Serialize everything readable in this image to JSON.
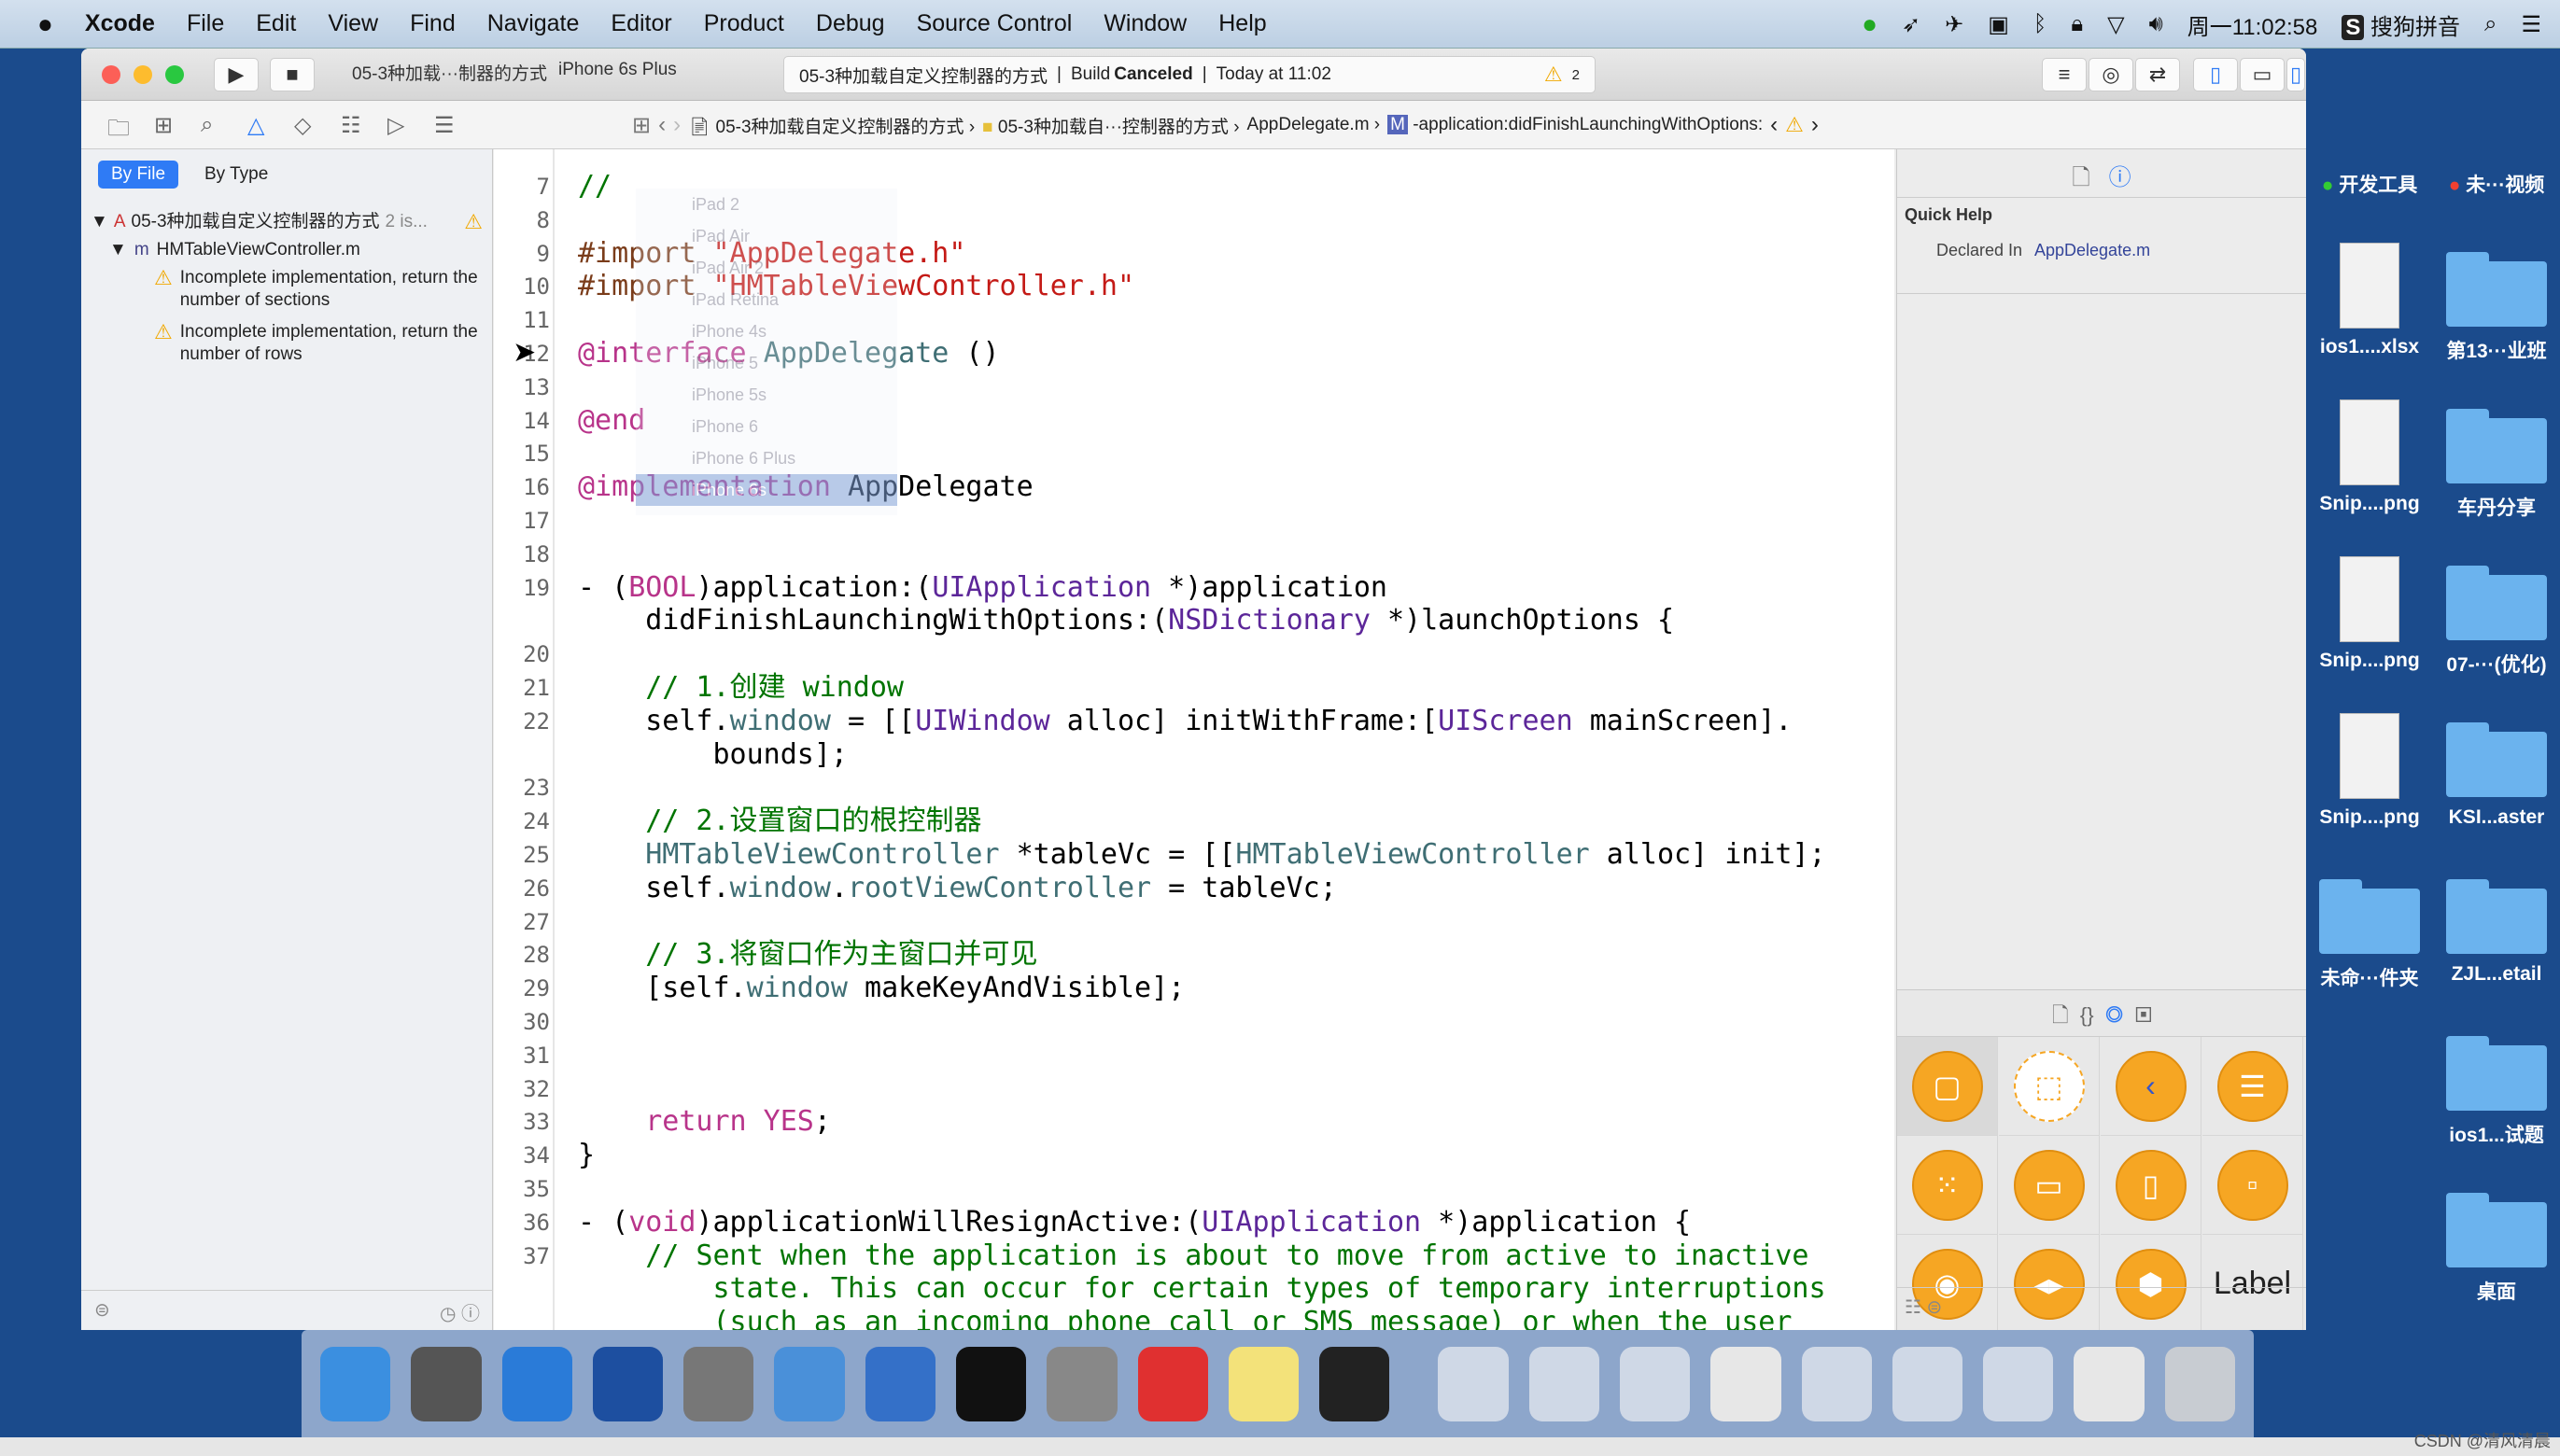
{
  "menubar": {
    "apple": "",
    "app": "Xcode",
    "items": [
      "File",
      "Edit",
      "View",
      "Find",
      "Navigate",
      "Editor",
      "Product",
      "Debug",
      "Source Control",
      "Window",
      "Help"
    ],
    "clock": "周一11:02:58",
    "ime": "搜狗拼音"
  },
  "toolbar": {
    "scheme": "05-3种加载···制器的方式",
    "device": "iPhone 6s Plus",
    "project": "05-3种加载自定义控制器的方式",
    "status_prefix": "Build",
    "status": "Canceled",
    "time": "Today at 11:02",
    "warnings": "2"
  },
  "jumpbar": [
    "05-3种加载自定义控制器的方式",
    "05-3种加载自···控制器的方式",
    "AppDelegate.m",
    "-application:didFinishLaunchingWithOptions:"
  ],
  "navigator": {
    "tabs": [
      "By File",
      "By Type"
    ],
    "project": "05-3种加载自定义控制器的方式",
    "project_count": "2 is...",
    "file": "HMTableViewController.m",
    "issues": [
      "Incomplete implementation, return the number of sections",
      "Incomplete implementation, return the number of rows"
    ]
  },
  "device_menu": [
    "iPad 2",
    "iPad Air",
    "iPad Air 2",
    "iPad Retina",
    "iPhone 4s",
    "iPhone 5",
    "iPhone 5s",
    "iPhone 6",
    "iPhone 6 Plus",
    "iPhone 6s"
  ],
  "device_menu_selected": "iPhone 6s",
  "code_lines": [
    {
      "n": "7",
      "t": [
        [
          "c",
          "//"
        ]
      ]
    },
    {
      "n": "8",
      "t": []
    },
    {
      "n": "9",
      "t": [
        [
          "pp",
          "#import "
        ],
        [
          "s",
          "\"AppDelegate.h\""
        ]
      ]
    },
    {
      "n": "10",
      "t": [
        [
          "pp",
          "#import "
        ],
        [
          "s",
          "\"HMTableViewController.h\""
        ]
      ]
    },
    {
      "n": "11",
      "t": []
    },
    {
      "n": "12",
      "t": [
        [
          "k",
          "@interface "
        ],
        [
          "cl",
          "AppDelegate"
        ],
        [
          "p",
          " ()"
        ]
      ]
    },
    {
      "n": "13",
      "t": []
    },
    {
      "n": "14",
      "t": [
        [
          "k",
          "@end"
        ]
      ]
    },
    {
      "n": "15",
      "t": []
    },
    {
      "n": "16",
      "t": [
        [
          "k",
          "@implementation "
        ],
        [
          "p",
          "AppDelegate"
        ]
      ]
    },
    {
      "n": "17",
      "t": []
    },
    {
      "n": "18",
      "t": []
    },
    {
      "n": "19",
      "t": [
        [
          "p",
          "- ("
        ],
        [
          "k",
          "BOOL"
        ],
        [
          "p",
          ")application:("
        ],
        [
          "sy",
          "UIApplication"
        ],
        [
          "p",
          " *)application"
        ]
      ]
    },
    {
      "n": "",
      "t": [
        [
          "p",
          "    didFinishLaunchingWithOptions:("
        ],
        [
          "sy",
          "NSDictionary"
        ],
        [
          "p",
          " *)launchOptions {"
        ]
      ]
    },
    {
      "n": "20",
      "t": []
    },
    {
      "n": "21",
      "t": [
        [
          "c",
          "    // 1.创建 window"
        ]
      ]
    },
    {
      "n": "22",
      "t": [
        [
          "p",
          "    self."
        ],
        [
          "cl",
          "window"
        ],
        [
          "p",
          " = [["
        ],
        [
          "sy",
          "UIWindow"
        ],
        [
          "p",
          " alloc] initWithFrame:["
        ],
        [
          "sy",
          "UIScreen"
        ],
        [
          "p",
          " mainScreen]."
        ]
      ]
    },
    {
      "n": "",
      "t": [
        [
          "p",
          "        bounds];"
        ]
      ]
    },
    {
      "n": "23",
      "t": []
    },
    {
      "n": "24",
      "t": [
        [
          "c",
          "    // 2.设置窗口的根控制器"
        ]
      ]
    },
    {
      "n": "25",
      "t": [
        [
          "p",
          "    "
        ],
        [
          "cl",
          "HMTableViewController"
        ],
        [
          "p",
          " *tableVc = [["
        ],
        [
          "cl",
          "HMTableViewController"
        ],
        [
          "p",
          " alloc] init];"
        ]
      ]
    },
    {
      "n": "26",
      "t": [
        [
          "p",
          "    self."
        ],
        [
          "cl",
          "window"
        ],
        [
          "p",
          "."
        ],
        [
          "cl",
          "rootViewController"
        ],
        [
          "p",
          " = tableVc;"
        ]
      ]
    },
    {
      "n": "27",
      "t": []
    },
    {
      "n": "28",
      "t": [
        [
          "c",
          "    // 3.将窗口作为主窗口并可见"
        ]
      ]
    },
    {
      "n": "29",
      "t": [
        [
          "p",
          "    [self."
        ],
        [
          "cl",
          "window"
        ],
        [
          "p",
          " makeKeyAndVisible];"
        ]
      ]
    },
    {
      "n": "30",
      "t": []
    },
    {
      "n": "31",
      "t": []
    },
    {
      "n": "32",
      "t": []
    },
    {
      "n": "33",
      "t": [
        [
          "k",
          "    return YES"
        ],
        [
          "p",
          ";"
        ]
      ]
    },
    {
      "n": "34",
      "t": [
        [
          "p",
          "}"
        ]
      ]
    },
    {
      "n": "35",
      "t": []
    },
    {
      "n": "36",
      "t": [
        [
          "p",
          "- ("
        ],
        [
          "k",
          "void"
        ],
        [
          "p",
          ")applicationWillResignActive:("
        ],
        [
          "sy",
          "UIApplication"
        ],
        [
          "p",
          " *)application {"
        ]
      ]
    },
    {
      "n": "37",
      "t": [
        [
          "c",
          "    // Sent when the application is about to move from active to inactive"
        ]
      ]
    },
    {
      "n": "",
      "t": [
        [
          "c",
          "        state. This can occur for certain types of temporary interruptions"
        ]
      ]
    },
    {
      "n": "",
      "t": [
        [
          "c",
          "        (such as an incoming phone call or SMS message) or when the user"
        ]
      ]
    }
  ],
  "inspector": {
    "title": "Quick Help",
    "declared_label": "Declared In",
    "declared_value": "AppDelegate.m"
  },
  "library": [
    {
      "icon": "view-controller-icon",
      "g": "▢"
    },
    {
      "icon": "storyboard-reference-icon",
      "g": "⬚"
    },
    {
      "icon": "navigation-controller-icon",
      "g": "‹"
    },
    {
      "icon": "table-view-controller-icon",
      "g": "☰"
    },
    {
      "icon": "collection-view-controller-icon",
      "g": "⁙"
    },
    {
      "icon": "tab-bar-controller-icon",
      "g": "▭"
    },
    {
      "icon": "page-view-controller-icon",
      "g": "▯"
    },
    {
      "icon": "glkit-view-controller-icon",
      "g": "▫"
    },
    {
      "icon": "avkit-player-icon",
      "g": "◉"
    },
    {
      "icon": "media-player-icon",
      "g": "◂▸"
    },
    {
      "icon": "object-icon",
      "g": "⬢"
    },
    {
      "icon": "label-icon",
      "label": "Label"
    }
  ],
  "desktop": [
    [
      "开发工具",
      "未···视频"
    ],
    [
      "ios1....xlsx",
      "第13···业班"
    ],
    [
      "Snip....png",
      "车丹分享"
    ],
    [
      "Snip....png",
      "07-···(优化)"
    ],
    [
      "Snip....png",
      "KSI...aster"
    ],
    [
      "未命···件夹",
      "ZJL...etail"
    ],
    [
      "",
      "ios1...试题"
    ],
    [
      "",
      "桌面"
    ]
  ],
  "dock": [
    {
      "n": "finder-icon",
      "c": "#3b8fe0"
    },
    {
      "n": "launchpad-icon",
      "c": "#555"
    },
    {
      "n": "safari-icon",
      "c": "#2a7bd8"
    },
    {
      "n": "mouse-app-icon",
      "c": "#1d4fa0"
    },
    {
      "n": "photo-slideshow-icon",
      "c": "#777"
    },
    {
      "n": "xcode-icon",
      "c": "#4a90d9"
    },
    {
      "n": "xcode-beta-icon",
      "c": "#3470c8"
    },
    {
      "n": "terminal-icon",
      "c": "#111"
    },
    {
      "n": "system-preferences-icon",
      "c": "#888"
    },
    {
      "n": "xmind-icon",
      "c": "#e03030"
    },
    {
      "n": "notes-icon",
      "c": "#f3e27a"
    },
    {
      "n": "exec-terminal-icon",
      "c": "#222"
    },
    {
      "n": "window-thumb-icon",
      "c": "#cfd8e6"
    },
    {
      "n": "window-thumb-icon",
      "c": "#cfd8e6"
    },
    {
      "n": "window-thumb-icon",
      "c": "#cfd8e6"
    },
    {
      "n": "window-thumb-icon",
      "c": "#e7e7e7"
    },
    {
      "n": "window-thumb-icon",
      "c": "#cfd8e6"
    },
    {
      "n": "window-thumb-icon",
      "c": "#cfd8e6"
    },
    {
      "n": "window-thumb-icon",
      "c": "#cfd8e6"
    },
    {
      "n": "window-thumb-icon",
      "c": "#e7e7e7"
    },
    {
      "n": "trash-icon",
      "c": "#c8ccd2"
    }
  ],
  "watermark": "CSDN @清风清晨",
  "colors": {
    "accent": "#2f7bf5",
    "warning": "#f0a800",
    "library_orange": "#f6a623",
    "desktop": "#1b4b8c"
  }
}
